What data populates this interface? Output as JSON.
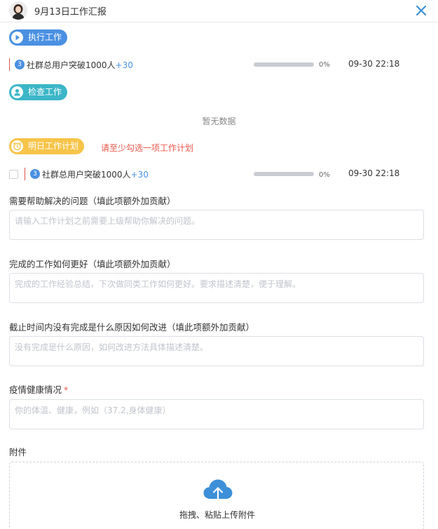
{
  "header": {
    "title": "9月13日工作汇报",
    "avatar_icon": "user-avatar",
    "close_icon": "close-icon"
  },
  "colors": {
    "accent_blue": "#4a90e2",
    "teal": "#3cb6c8",
    "yellow": "#f7c44a",
    "warning_red": "#e9594c"
  },
  "exec_section": {
    "label": "执行工作",
    "icon": "play-icon",
    "tasks": [
      {
        "badge": "3",
        "name": "社群总用户突破1000人",
        "bonus": "+30",
        "progress": 0,
        "progress_text": "0%",
        "time": "09-30 22:18"
      }
    ]
  },
  "check_section": {
    "label": "检查工作",
    "icon": "user-icon",
    "empty_text": "暂无数据"
  },
  "plan_section": {
    "label": "明日工作计划",
    "icon": "alarm-clock-icon",
    "warning": "请至少勾选一项工作计划",
    "tasks": [
      {
        "badge": "3",
        "name": "社群总用户突破1000人",
        "bonus": "+30",
        "progress": 0,
        "progress_text": "0%",
        "time": "09-30 22:18",
        "checked": false
      }
    ]
  },
  "fields": [
    {
      "label": "需要帮助解决的问题（填此项额外加贡献）",
      "placeholder": "请输入工作计划之前需要上级帮助你解决的问题。",
      "value": "",
      "required": false
    },
    {
      "label": "完成的工作如何更好（填此项额外加贡献）",
      "placeholder": "完成的工作经验总结，下次做同类工作如何更好。要求描述清楚，便于理解。",
      "value": "",
      "required": false
    },
    {
      "label": "截止时间内没有完成是什么原因如何改进（填此项额外加贡献）",
      "placeholder": "没有完成是什么原因，如何改进方法具体描述清楚。",
      "value": "",
      "required": false
    },
    {
      "label": "疫情健康情况",
      "required_mark": "*",
      "placeholder": "你的体温、健康，例如（37.2,身体健康）",
      "value": "",
      "required": true
    }
  ],
  "attachments": {
    "label": "附件",
    "upload_text": "拖拽、粘贴上传附件",
    "icon": "cloud-upload-icon"
  }
}
